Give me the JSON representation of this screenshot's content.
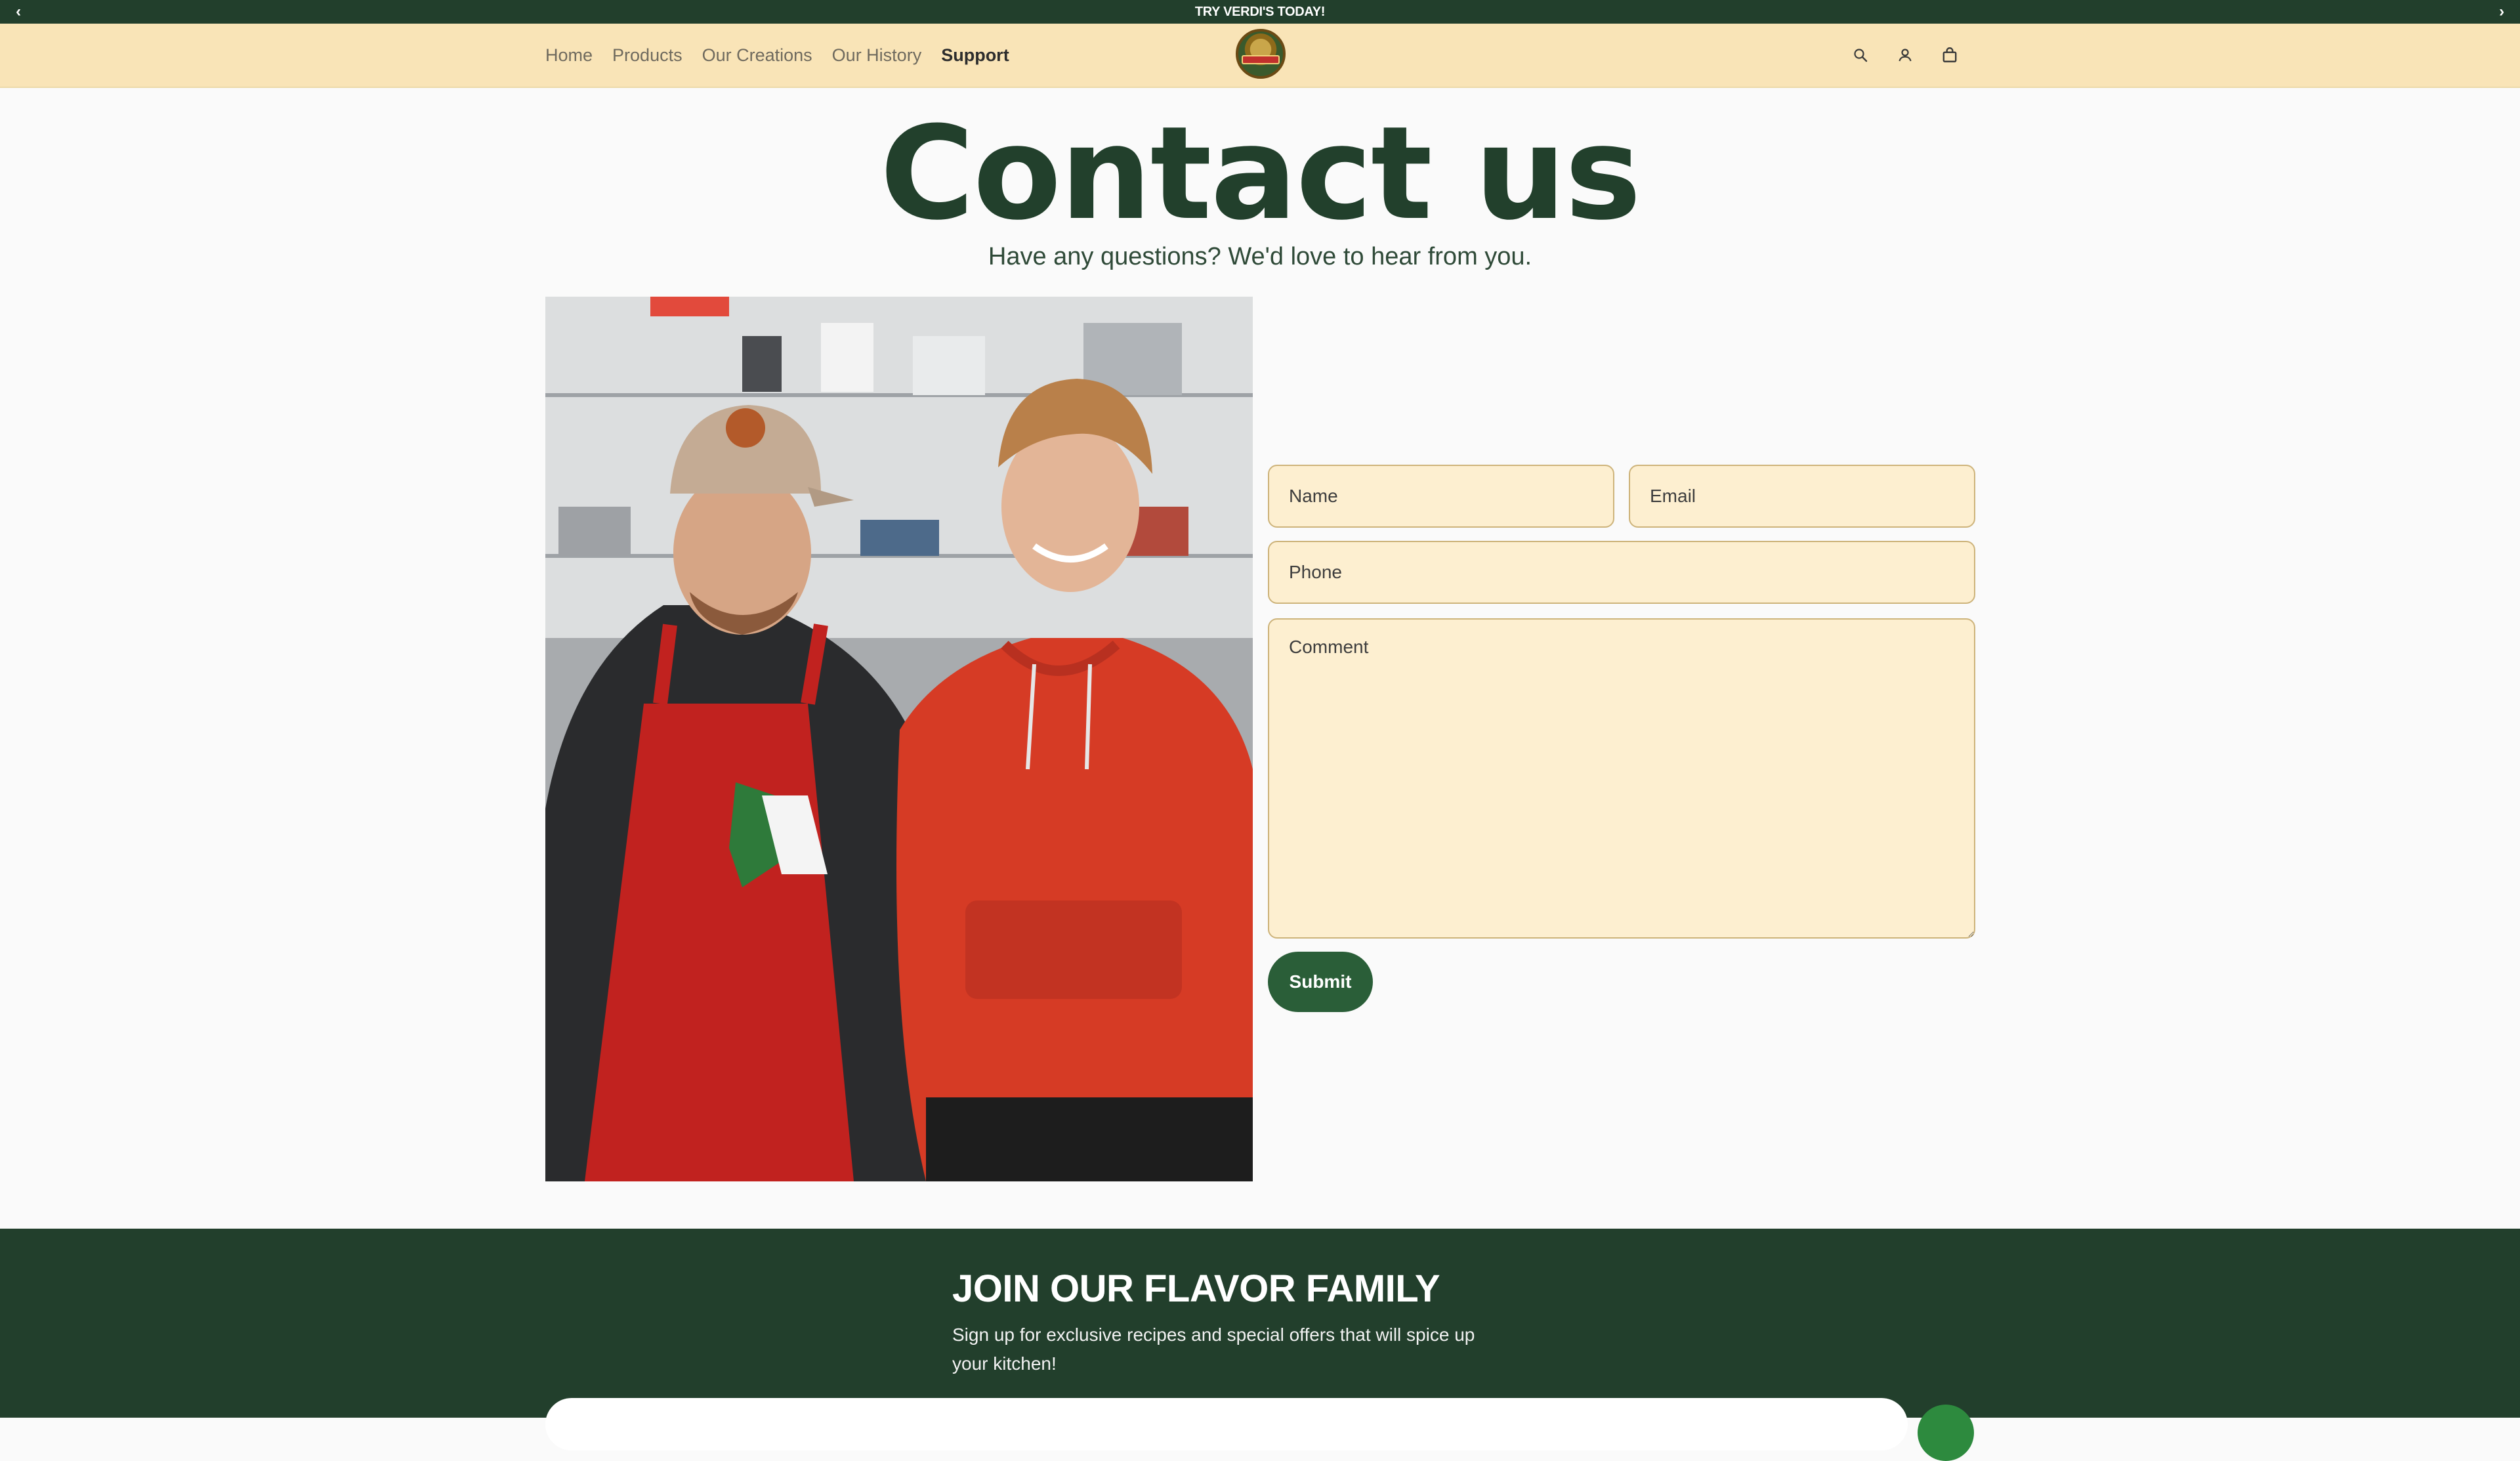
{
  "announcement": {
    "text": "TRY VERDI'S TODAY!",
    "prev_icon": "chevron-left-icon",
    "next_icon": "chevron-right-icon"
  },
  "header": {
    "nav": [
      {
        "label": "Home"
      },
      {
        "label": "Products"
      },
      {
        "label": "Our Creations"
      },
      {
        "label": "Our History"
      },
      {
        "label": "Support",
        "active": true
      }
    ],
    "icons": [
      "search-icon",
      "account-icon",
      "cart-icon"
    ]
  },
  "hero": {
    "title": "Contact us",
    "subtitle": "Have any questions? We'd love to hear from you."
  },
  "form": {
    "name_placeholder": "Name",
    "email_placeholder": "Email",
    "phone_placeholder": "Phone",
    "comment_placeholder": "Comment",
    "submit_label": "Submit"
  },
  "footer": {
    "heading": "JOIN OUR FLAVOR FAMILY",
    "text": "Sign up for exclusive recipes and special offers that will spice up your kitchen!"
  },
  "colors": {
    "dark_green": "#223f2c",
    "header_bg": "#f9e4b7",
    "field_bg": "#fdefd0",
    "button_green": "#2a5e38"
  }
}
